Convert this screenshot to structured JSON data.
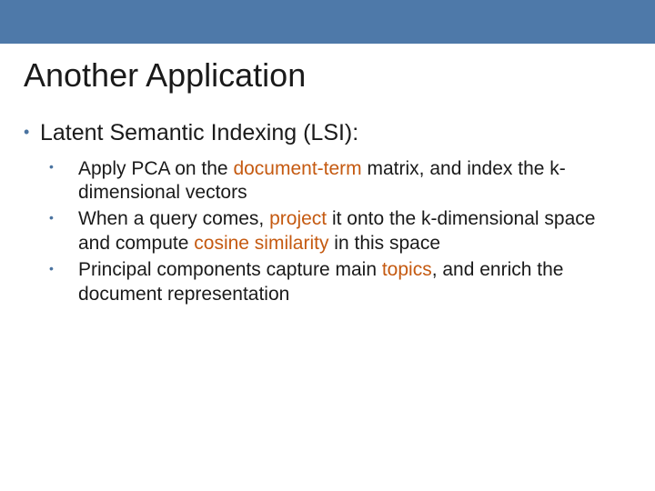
{
  "slide": {
    "title": "Another Application",
    "main": {
      "prefix": "Latent Semantic Indexing",
      "suffix": " (LSI):"
    },
    "subs": [
      {
        "t1": "Apply PCA on the ",
        "h1": "document-term",
        "t2": " matrix, and index the k-dimensional vectors"
      },
      {
        "t1": "When a query comes, ",
        "h1": "project",
        "t2": " it onto the k-dimensional space and compute ",
        "h2": "cosine similarity",
        "t3": " in this space"
      },
      {
        "t1": "Principal components capture main ",
        "h1": "topics",
        "t2": ", and enrich the document representation"
      }
    ]
  }
}
